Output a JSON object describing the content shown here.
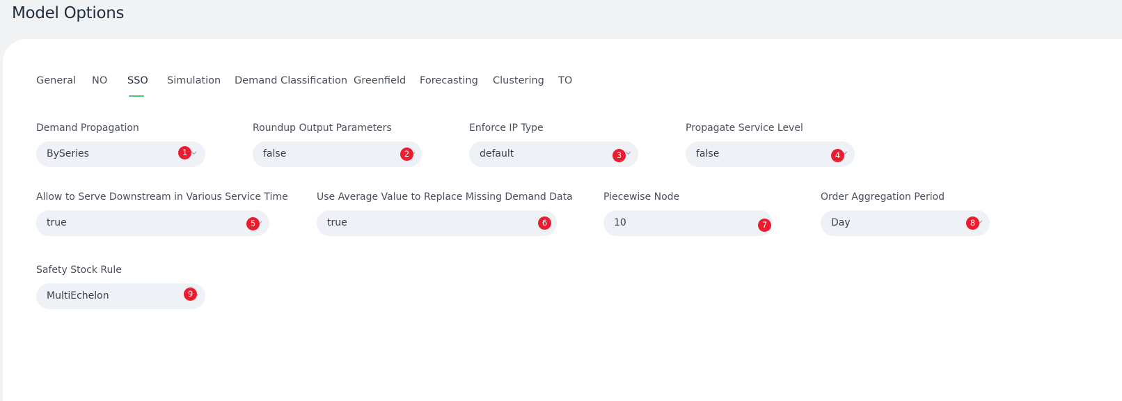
{
  "page_title": "Model Options",
  "tabs": [
    {
      "label": "General"
    },
    {
      "label": "NO"
    },
    {
      "label": "SSO",
      "active": true
    },
    {
      "label": "Simulation"
    },
    {
      "label": "Demand Classification"
    },
    {
      "label": "Greenfield"
    },
    {
      "label": "Forecasting"
    },
    {
      "label": "Clustering"
    },
    {
      "label": "TO"
    }
  ],
  "fields": [
    {
      "label": "Demand Propagation",
      "value": "BySeries",
      "badge": "1"
    },
    {
      "label": "Roundup Output Parameters",
      "value": "false",
      "badge": "2"
    },
    {
      "label": "Enforce IP Type",
      "value": "default",
      "badge": "3"
    },
    {
      "label": "Propagate Service Level",
      "value": "false",
      "badge": "4"
    },
    {
      "label": "Allow to Serve Downstream in Various Service Time",
      "value": "true",
      "badge": "5"
    },
    {
      "label": "Use Average Value to Replace Missing Demand Data",
      "value": "true",
      "badge": "6"
    },
    {
      "label": "Piecewise Node",
      "value": "10",
      "badge": "7"
    },
    {
      "label": "Order Aggregation Period",
      "value": "Day",
      "badge": "8"
    },
    {
      "label": "Safety Stock Rule",
      "value": "MultiEchelon",
      "badge": "9"
    }
  ],
  "colors": {
    "background": "#f1f2f4",
    "card": "#ffffff",
    "field": "#eef1f5",
    "active_tab_underline": "#52c27a",
    "badge": "#ea1c2e"
  },
  "icons": {
    "dropdown": "chevron-down-icon"
  }
}
